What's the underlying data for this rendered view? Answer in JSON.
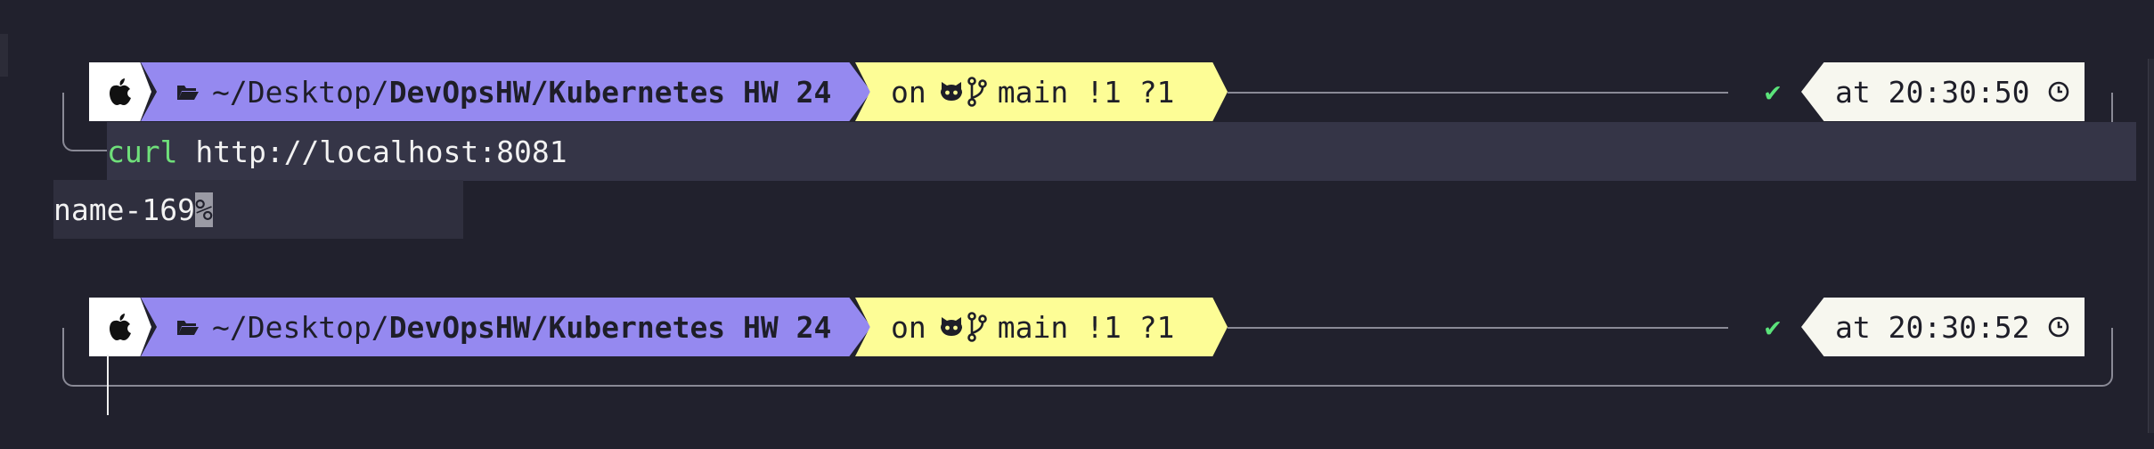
{
  "terminal": {
    "prompts": [
      {
        "path_prefix": "~/Desktop/",
        "path_bold": "DevOpsHW/Kubernetes HW 24",
        "git_on": "on",
        "git_branch": "main !1 ?1",
        "status_mark": "✔",
        "time_label": "at 20:30:50"
      },
      {
        "path_prefix": "~/Desktop/",
        "path_bold": "DevOpsHW/Kubernetes HW 24",
        "git_on": "on",
        "git_branch": "main !1 ?1",
        "status_mark": "✔",
        "time_label": "at 20:30:52"
      }
    ],
    "command": {
      "name": "curl",
      "args": " http://localhost:8081"
    },
    "output": {
      "text": "name-169",
      "eol_mark": "%"
    }
  },
  "colors": {
    "background": "#21212d",
    "path_segment": "#9589f0",
    "git_segment": "#fdfd96",
    "status_ok": "#5be37a",
    "command_name": "#6fe07a"
  },
  "icons": [
    "apple-icon",
    "folder-icon",
    "github-icon",
    "git-branch-icon",
    "check-icon",
    "clock-icon"
  ]
}
